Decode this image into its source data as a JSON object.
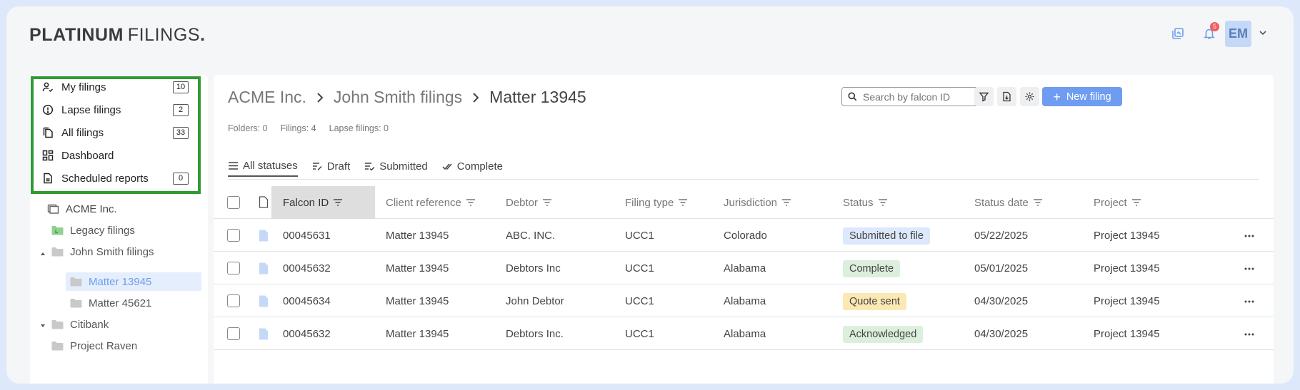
{
  "brand": {
    "bold": "PLATINUM",
    "regular": "FILINGS",
    "dot": "."
  },
  "header": {
    "notifications_count": "5",
    "avatar_initials": "EM"
  },
  "sidebar": {
    "nav": [
      {
        "label": "My filings",
        "count": "10",
        "icon": "user-filings-icon"
      },
      {
        "label": "Lapse filings",
        "count": "2",
        "icon": "alert-circle-icon"
      },
      {
        "label": "All filings",
        "count": "33",
        "icon": "copy-documents-icon"
      },
      {
        "label": "Dashboard",
        "count": null,
        "icon": "dashboard-grid-icon"
      },
      {
        "label": "Scheduled reports",
        "count": "0",
        "icon": "report-icon"
      }
    ],
    "tree": [
      {
        "label": "ACME Inc.",
        "icon": "organization-icon"
      },
      {
        "label": "Legacy filings",
        "icon": "folder-green-icon"
      },
      {
        "label": "John Smith filings",
        "icon": "folder-icon",
        "expanded": true
      },
      {
        "label": "Matter 13945",
        "icon": "folder-icon",
        "active": true
      },
      {
        "label": "Matter 45621",
        "icon": "folder-icon"
      },
      {
        "label": "Citibank",
        "icon": "folder-icon",
        "expanded": true
      },
      {
        "label": "Project Raven",
        "icon": "folder-icon"
      }
    ]
  },
  "main": {
    "breadcrumb": [
      "ACME Inc.",
      "John Smith filings",
      "Matter 13945"
    ],
    "counts": [
      "Folders: 0",
      "Filings: 4",
      "Lapse filings: 0"
    ],
    "search_placeholder": "Search by falcon ID",
    "new_button": "New filing",
    "tabs": [
      "All statuses",
      "Draft",
      "Submitted",
      "Complete"
    ],
    "columns": [
      "Falcon ID",
      "Client reference",
      "Debtor",
      "Filing type",
      "Jurisdiction",
      "Status",
      "Status date",
      "Project"
    ],
    "rows": [
      {
        "id": "00045631",
        "ref": "Matter 13945",
        "debtor": "ABC. INC.",
        "type": "UCC1",
        "jurisdiction": "Colorado",
        "status": "Submitted to file",
        "date": "05/22/2025",
        "project": "Project 13945"
      },
      {
        "id": "00045632",
        "ref": "Matter 13945",
        "debtor": "Debtors Inc",
        "type": "UCC1",
        "jurisdiction": "Alabama",
        "status": "Complete",
        "date": "05/01/2025",
        "project": "Project 13945"
      },
      {
        "id": "00045634",
        "ref": "Matter 13945",
        "debtor": "John Debtor",
        "type": "UCC1",
        "jurisdiction": "Alabama",
        "status": "Quote sent",
        "date": "04/30/2025",
        "project": "Project 13945"
      },
      {
        "id": "00045632",
        "ref": "Matter 13945",
        "debtor": "Debtors Inc.",
        "type": "UCC1",
        "jurisdiction": "Alabama",
        "status": "Acknowledged",
        "date": "04/30/2025",
        "project": "Project 13945"
      }
    ]
  },
  "colors": {
    "highlight_border": "#2e9a32",
    "primary": "#6e9cf0",
    "status_submitted_bg": "#dce8fb",
    "status_complete_bg": "#dcefdc",
    "status_quote_bg": "#fbe9b4",
    "status_ack_bg": "#dcefdc"
  }
}
